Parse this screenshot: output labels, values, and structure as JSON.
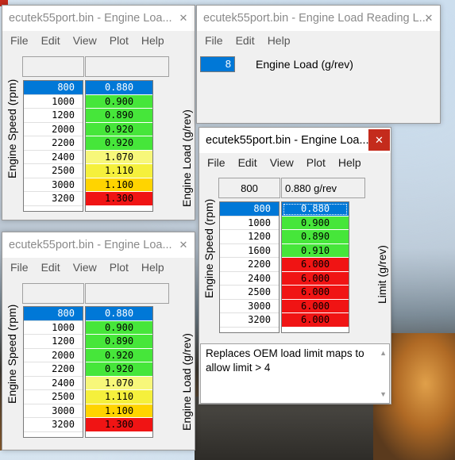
{
  "colors": {
    "green": "#46e63a",
    "yellow": "#f5f03c",
    "yellow_light": "#f7f77a",
    "gold": "#ffd400",
    "red": "#f01414",
    "selected": "#0078d7"
  },
  "menu": [
    "File",
    "Edit",
    "View",
    "Plot",
    "Help"
  ],
  "menu_short": [
    "File",
    "Edit",
    "Help"
  ],
  "win1": {
    "title": "ecutek55port.bin - Engine Loa...",
    "ylabel": "Engine Speed (rpm)",
    "vlabel": "Engine Load (g/rev)",
    "rpm": [
      "800",
      "1000",
      "1200",
      "2000",
      "2200",
      "2400",
      "2500",
      "3000",
      "3200"
    ],
    "values": [
      "0.880",
      "0.900",
      "0.890",
      "0.920",
      "0.920",
      "1.070",
      "1.110",
      "1.100",
      "1.300"
    ],
    "value_colors": [
      "selected",
      "green",
      "green",
      "green",
      "green",
      "yellow_light",
      "yellow",
      "gold",
      "red"
    ]
  },
  "win2": {
    "title": "ecutek55port.bin - Engine Load Reading L...",
    "spin_value": "8",
    "label": "Engine Load (g/rev)"
  },
  "win3": {
    "title": "ecutek55port.bin - Engine Loa...",
    "ylabel": "Engine Speed (rpm)",
    "vlabel": "Engine Load (g/rev)",
    "rpm": [
      "800",
      "1000",
      "1200",
      "2000",
      "2200",
      "2400",
      "2500",
      "3000",
      "3200"
    ],
    "values": [
      "0.880",
      "0.900",
      "0.890",
      "0.920",
      "0.920",
      "1.070",
      "1.110",
      "1.100",
      "1.300"
    ],
    "value_colors": [
      "selected",
      "green",
      "green",
      "green",
      "green",
      "yellow_light",
      "yellow",
      "gold",
      "red"
    ]
  },
  "win4": {
    "title": "ecutek55port.bin - Engine Loa...",
    "header_rpm": "800",
    "header_value": "0.880 g/rev",
    "ylabel": "Engine Speed (rpm)",
    "vlabel": "Limit (g/rev)",
    "rpm": [
      "800",
      "1000",
      "1200",
      "1600",
      "2200",
      "2400",
      "2500",
      "3000",
      "3200"
    ],
    "values": [
      "0.880",
      "0.900",
      "0.890",
      "0.910",
      "6.000",
      "6.000",
      "6.000",
      "6.000",
      "6.000"
    ],
    "value_colors": [
      "selected",
      "green",
      "green",
      "green",
      "red",
      "red",
      "red",
      "red",
      "red"
    ],
    "description": "Replaces OEM load limit maps to allow limit > 4"
  }
}
